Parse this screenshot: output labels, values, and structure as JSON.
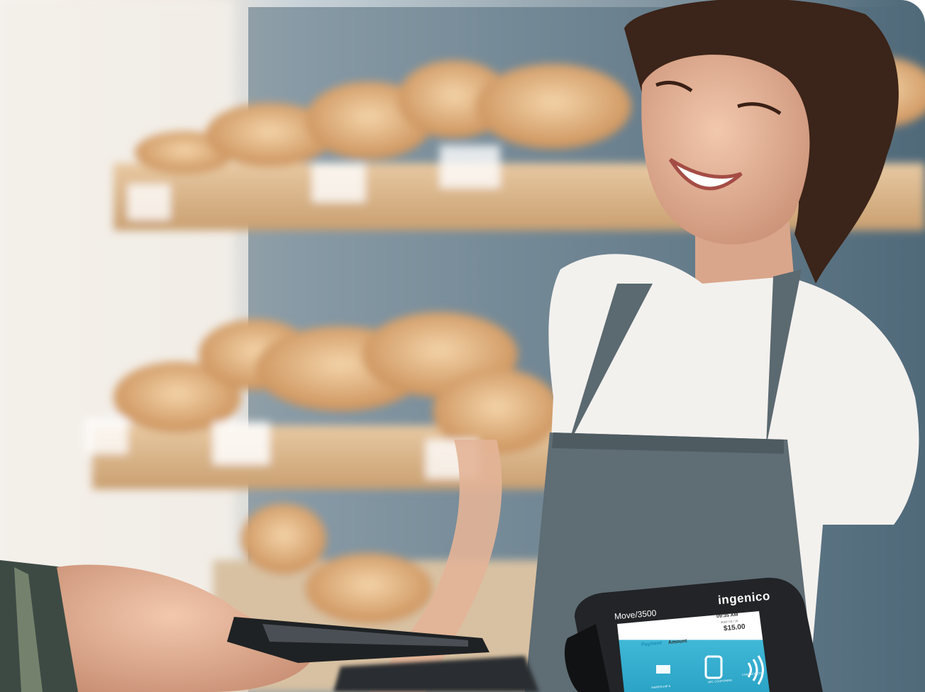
{
  "photo": {
    "description_icon": "bakery-payment-photo-icon"
  },
  "terminal": {
    "brand": "ingenico",
    "model": "Move/3500",
    "time": "09:35 AM",
    "date": "2020 / 01 / 15",
    "tab_payment": "Payment",
    "tab_amount": "Amount",
    "amount": "$15.00",
    "option_1": "SWIPE/CHIP &",
    "option_2": "NFC COUPONING",
    "option_3": "CONTACTLESS"
  },
  "colors": {
    "wall_blue": "#4f6877",
    "shelf_wood": "#d9b58a",
    "apron": "#5c6a70",
    "shirt": "#f4f2ef",
    "screen_teal": "#37b4d4"
  }
}
